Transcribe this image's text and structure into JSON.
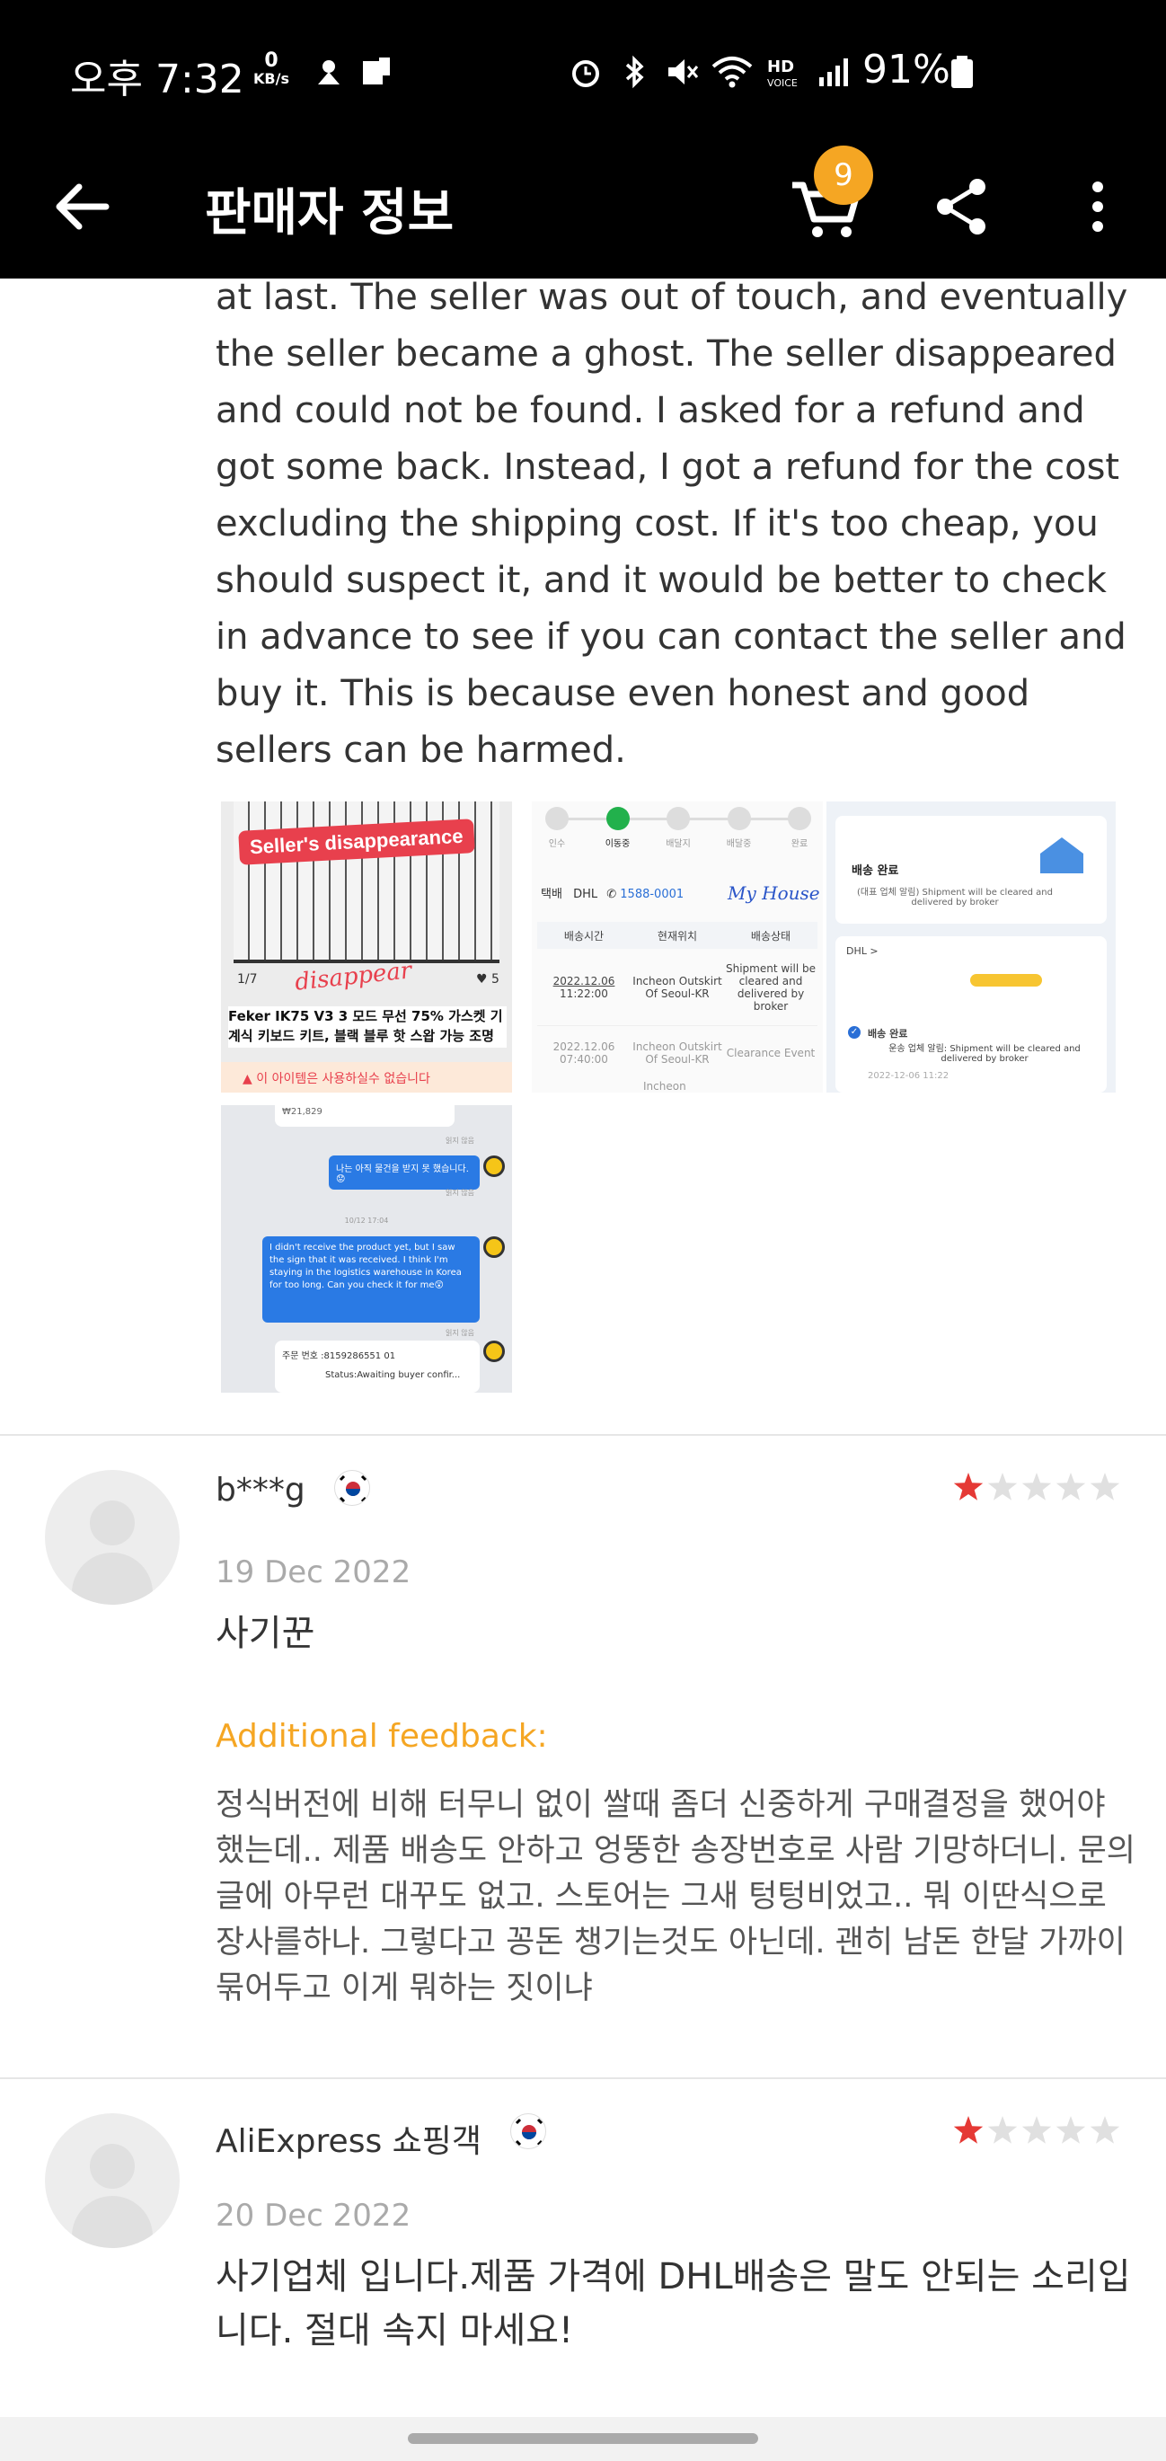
{
  "status_bar": {
    "time": "오후 7:32",
    "net_speed_value": "0",
    "net_speed_unit": "KB/s",
    "battery": "91%",
    "icons": [
      "network-speed",
      "notification-icon",
      "sim-icon",
      "alarm-icon",
      "bluetooth-icon",
      "mute-icon",
      "wifi-icon",
      "hd-voice-icon",
      "signal-icon",
      "battery-icon"
    ]
  },
  "toolbar": {
    "title": "판매자 정보",
    "cart_count": "9",
    "back_icon": "arrow-left-icon",
    "cart_icon": "cart-icon",
    "share_icon": "share-icon",
    "more_icon": "more-vertical-icon"
  },
  "review_continued": {
    "text": "at last. The seller was out of touch, and eventually the seller became a ghost. The seller disappeared and could not be found. I asked for a refund and got some back. Instead, I got a refund for the cost excluding the shipping cost. If it's too cheap, you should suspect it, and it would be better to check in advance to see if you can contact the seller and buy it. This is because even honest and good sellers can be harmed."
  },
  "photos": {
    "photo1": {
      "banner": "Seller's disappearance",
      "annotation": "disappear",
      "counter": "1/7",
      "likes": "5",
      "product": "Feker IK75 V3 3 모드 무선 75% 가스켓 기계식 키보드 키트, 블랙 블루 핫 스왑 가능 조명 효과...",
      "warning": "이 아이템은 사용하실수 없습니다"
    },
    "photo2": {
      "steps": [
        "인수",
        "이동중",
        "배달지",
        "배달중",
        "완료"
      ],
      "carrier_label": "택배",
      "carrier": "DHL",
      "phone": "1588-0001",
      "annotation": "My House",
      "col_time": "배송시간",
      "col_location": "현재위치",
      "col_status": "배송상태",
      "row1_date": "2022.12.06",
      "row1_time": "11:22:00",
      "row1_location": "Incheon Outskirt Of Seoul-KR",
      "row1_status": "Shipment will be cleared and delivered by broker",
      "row2_date": "2022.12.06",
      "row2_time": "07:40:00",
      "row2_location": "Incheon Outskirt Of Seoul-KR",
      "row2_status": "Clearance Event",
      "row3_location": "Incheon"
    },
    "photo3": {
      "title": "배송 완료",
      "desc": "(대표 업체 알림) Shipment will be cleared and delivered by broker",
      "carrier": "DHL >",
      "status_title": "배송 완료",
      "status_desc": "운송 업체 알림: Shipment will be cleared and delivered by broker",
      "status_date": "2022-12-06 11:22"
    },
    "photo4": {
      "amount": "₩21,829",
      "read1": "읽지 않음",
      "msg1": "나는 아직 물건을 받지 못 했습니다.😟",
      "read2": "읽지 않음",
      "date_sep": "10/12 17:04",
      "msg2": "I didn't receive the product yet, but I saw the sign that it was received. I think I'm staying in the logistics warehouse in Korea for too long. Can you check it for me😲",
      "read3": "읽지 않음",
      "order_label": "주문 번호 :8159286551  01",
      "order_status": "Status:Awaiting buyer confir..."
    }
  },
  "reviews": [
    {
      "name": "b***g",
      "country": "KR",
      "rating": 1,
      "date": "19 Dec 2022",
      "text": "사기꾼",
      "feedback_label": "Additional feedback:",
      "feedback": "정식버전에 비해 터무니 없이 쌀때 좀더 신중하게 구매결정을 했어야 했는데.. 제품 배송도 안하고 엉뚱한 송장번호로 사람 기망하더니. 문의글에 아무런 대꾸도 없고. 스토어는 그새 텅텅비었고.. 뭐 이딴식으로 장사를하나. 그렇다고 꽁돈 챙기는것도 아닌데. 괜히 남돈 한달 가까이 묶어두고 이게 뭐하는 짓이냐"
    },
    {
      "name": "AliExpress 쇼핑객",
      "country": "KR",
      "rating": 1,
      "date": "20 Dec 2022",
      "text": "사기업체 입니다.제품 가격에 DHL배송은 말도 안되는 소리입니다. 절대 속지 마세요!"
    }
  ],
  "colors": {
    "accent": "#f5a623",
    "star_filled": "#e53935",
    "star_empty": "#e0e0e0",
    "topbar": "#000000"
  }
}
